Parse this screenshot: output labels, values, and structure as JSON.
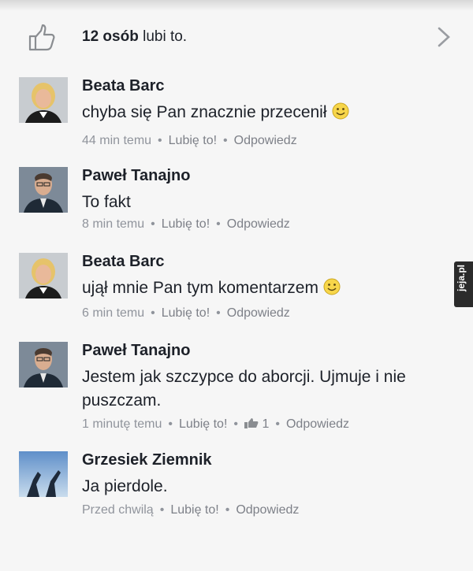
{
  "likes_summary": {
    "count_text": "12 osób",
    "suffix_text": " lubi to.",
    "icon": "thumbs-up-icon",
    "open_icon": "chevron-right-icon"
  },
  "actions": {
    "like": "Lubię to!",
    "reply": "Odpowiedz",
    "separator": "•"
  },
  "comments": [
    {
      "author": "Beata Barc",
      "text": "chyba się Pan znacznie przecenił",
      "emoji": "smiley-icon",
      "time": "44 min temu"
    },
    {
      "author": "Paweł Tanajno",
      "text": "To fakt",
      "time": "8 min temu"
    },
    {
      "author": "Beata Barc",
      "text": "ujął mnie Pan tym komentarzem",
      "emoji": "smiley-icon",
      "time": "6 min temu"
    },
    {
      "author": "Paweł Tanajno",
      "text": "Jestem jak szczypce do aborcji. Ujmuje i nie puszczam.",
      "time": "1 minutę temu",
      "like_count": "1"
    },
    {
      "author": "Grzesiek Ziemnik",
      "text": "Ja pierdole.",
      "time": "Przed chwilą"
    }
  ],
  "watermark": "jeja.pl",
  "colors": {
    "background": "#f6f6f6",
    "text": "#1d2129",
    "meta": "#90949c",
    "icon": "#8a8d91"
  }
}
